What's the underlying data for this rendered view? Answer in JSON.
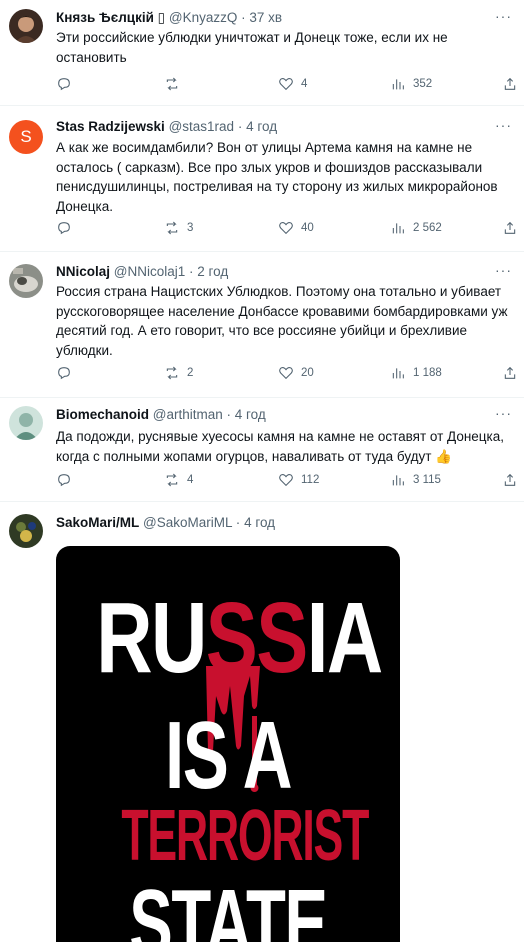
{
  "tweets": [
    {
      "name": "Князь Ѣєлцкій ▯",
      "handle": "@KnyazzQ",
      "time": "37 хв",
      "text": "Эти российские ублюдки уничтожат и Донецк тоже, если их не остановить",
      "replies": "",
      "retweets": "",
      "likes": "4",
      "views": "352"
    },
    {
      "name": "Stas Radzijewski",
      "handle": "@stas1rad",
      "time": "4 год",
      "avatar_letter": "S",
      "text": "А как же восимдамбили?  Вон от улицы Артема камня на камне не осталось ( сарказм). Все про злых укров и фошиздов рассказывали пенисдушилинцы,  постреливая на ту сторону из жилых микрорайонов Донецка.",
      "replies": "",
      "retweets": "3",
      "likes": "40",
      "views": "2 562"
    },
    {
      "name": "NNicolaj",
      "handle": "@NNicolaj1",
      "time": "2 год",
      "text": "Россия страна Нацистских Ублюдков. Поэтому она тотально и убивает русскоговорящее население Донбассе кровавими бомбардировками уж десятий год. А ето говорит, что все россияне убийци и брехливие ублюдки.",
      "replies": "",
      "retweets": "2",
      "likes": "20",
      "views": "1 188"
    },
    {
      "name": "Biomechanoid",
      "handle": "@arthitman",
      "time": "4 год",
      "text": "Да подожди, руснявые хуесосы камня на камне не оставят от Донецка, когда с полными жопами огурцов, наваливать от туда будут 👍",
      "replies": "",
      "retweets": "4",
      "likes": "112",
      "views": "3 115"
    },
    {
      "name": "SakoMari/ML",
      "handle": "@SakoMariML",
      "time": "4 год",
      "image_text": {
        "line1_a": "RU",
        "line1_b": "SS",
        "line1_c": "IA",
        "line2": "IS A",
        "line3": "TERRORIST",
        "line4": "STATE"
      }
    }
  ],
  "dot": "·",
  "more_label": "···",
  "colors": {
    "text": "#0f1419",
    "muted": "#536471",
    "border": "#eff3f4",
    "poster_red": "#c8102e"
  }
}
